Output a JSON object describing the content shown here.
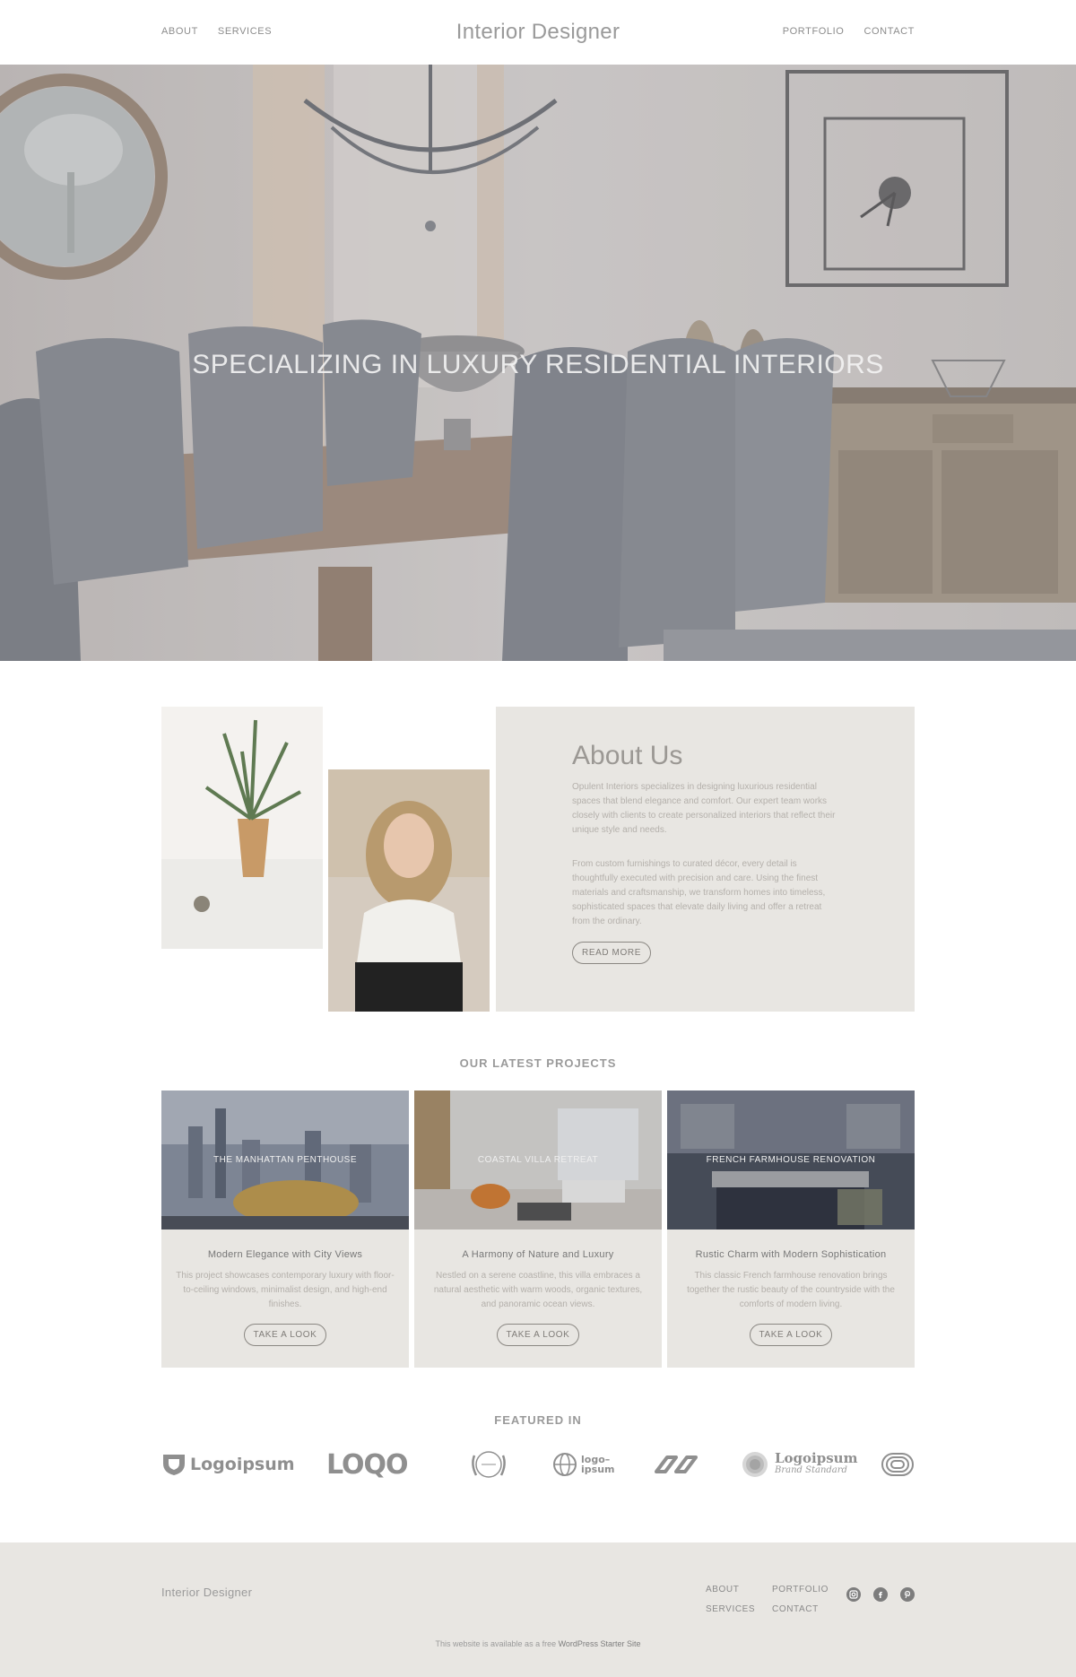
{
  "header": {
    "brand": "Interior Designer",
    "nav_left": [
      "ABOUT",
      "SERVICES"
    ],
    "nav_right": [
      "PORTFOLIO",
      "CONTACT"
    ]
  },
  "hero": {
    "title": "SPECIALIZING IN LUXURY RESIDENTIAL INTERIORS"
  },
  "about": {
    "title": "About Us",
    "paragraph1": "Opulent Interiors specializes in designing luxurious residential spaces that blend elegance and comfort. Our expert team works closely with clients to create personalized interiors that reflect their unique style and needs.",
    "paragraph2": "From custom furnishings to curated décor, every detail is thoughtfully executed with precision and care. Using the finest materials and craftsmanship, we transform homes into timeless, sophisticated spaces that elevate daily living and offer a retreat from the ordinary.",
    "button": "READ MORE"
  },
  "projects": {
    "heading": "OUR LATEST PROJECTS",
    "items": [
      {
        "image_label": "THE MANHATTAN PENTHOUSE",
        "title": "Modern Elegance with City Views",
        "description": "This project showcases contemporary luxury with floor-to-ceiling windows, minimalist design, and high-end finishes.",
        "button": "TAKE A LOOK"
      },
      {
        "image_label": "COASTAL VILLA RETREAT",
        "title": "A Harmony of Nature and Luxury",
        "description": "Nestled on a serene coastline, this villa embraces a natural aesthetic with warm woods, organic textures, and panoramic ocean views.",
        "button": "TAKE A LOOK"
      },
      {
        "image_label": "FRENCH FARMHOUSE RENOVATION",
        "title": "Rustic Charm with Modern Sophistication",
        "description": "This classic French farmhouse renovation brings together the rustic beauty of the countryside with the comforts of modern living.",
        "button": "TAKE A LOOK"
      }
    ]
  },
  "featured": {
    "heading": "FEATURED IN",
    "logos": [
      {
        "icon": "shield-logo-icon",
        "text": "Logoipsum"
      },
      {
        "icon": "loqo-logo-icon",
        "text": "LOQO"
      },
      {
        "icon": "laurel-badge-logo-icon",
        "text": ""
      },
      {
        "icon": "globe-logo-icon",
        "text": "logo– ipsum"
      },
      {
        "icon": "chain-logo-icon",
        "text": ""
      },
      {
        "icon": "circle-lines-logo-icon",
        "text": "Logoipsum",
        "subtext": "Brand Standard"
      },
      {
        "icon": "oval-rings-logo-icon",
        "text": ""
      }
    ]
  },
  "footer": {
    "brand": "Interior Designer",
    "nav_col1": [
      "ABOUT",
      "SERVICES"
    ],
    "nav_col2": [
      "PORTFOLIO",
      "CONTACT"
    ],
    "social": [
      "instagram-icon",
      "facebook-icon",
      "pinterest-icon"
    ],
    "credit_prefix": "This website is available as a free ",
    "credit_link": "WordPress Starter Site"
  },
  "colors": {
    "panel_bg": "#e8e6e2",
    "text_muted": "#9a9a9a",
    "button_border": "#8a8782"
  }
}
